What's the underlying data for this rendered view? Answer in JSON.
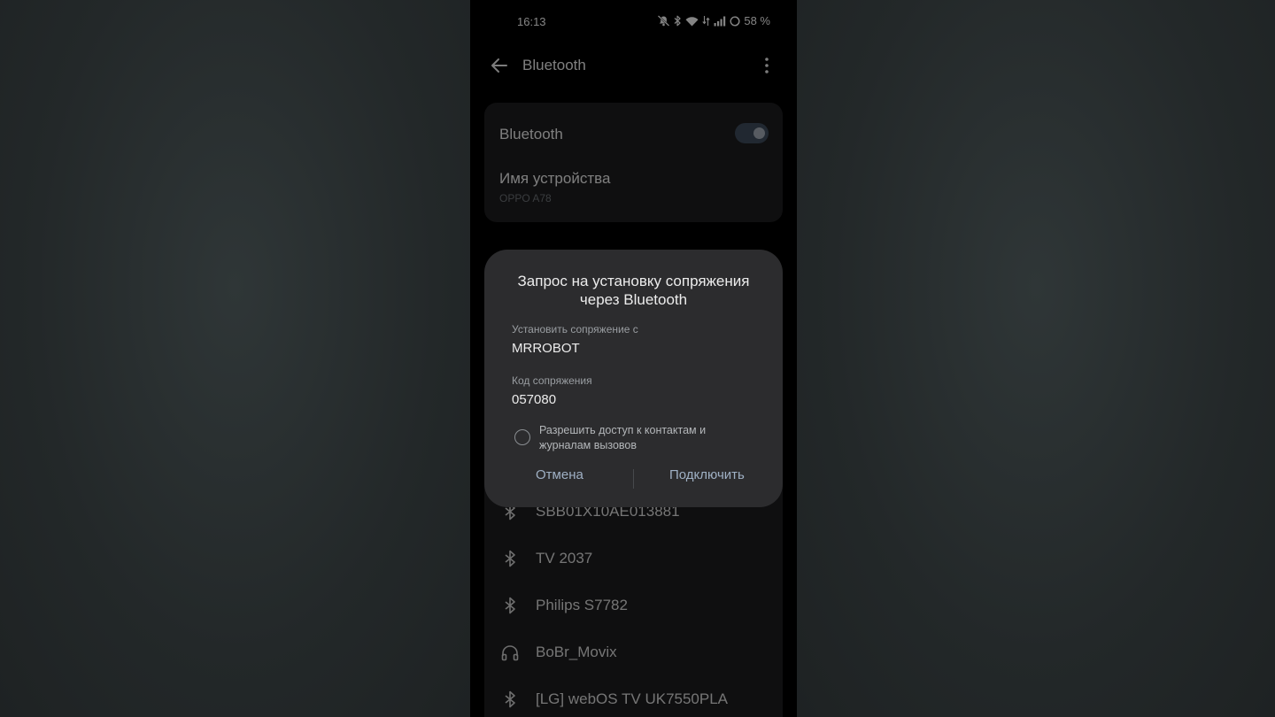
{
  "status_bar": {
    "time": "16:13",
    "battery": "58 %",
    "icons": [
      "mute-vibrate-icon",
      "bluetooth-icon",
      "wifi-icon",
      "data-icon",
      "signal-icon",
      "battery-icon"
    ]
  },
  "app_bar": {
    "title": "Bluetooth",
    "back_icon": "arrow-left-icon",
    "more_icon": "more-vertical-icon"
  },
  "settings": {
    "bluetooth_label": "Bluetooth",
    "bluetooth_enabled": true,
    "device_name_label": "Имя устройства",
    "device_name_value": "OPPO A78"
  },
  "devices": [
    {
      "name": "SBB01X10AE013881",
      "icon": "bluetooth-icon"
    },
    {
      "name": "TV 2037",
      "icon": "bluetooth-icon"
    },
    {
      "name": "Philips S7782",
      "icon": "bluetooth-icon"
    },
    {
      "name": "BoBr_Movix",
      "icon": "headphones-icon"
    },
    {
      "name": "[LG] webOS TV UK7550PLA",
      "icon": "bluetooth-icon"
    }
  ],
  "dialog": {
    "title": "Запрос на установку сопряжения через Bluetooth",
    "pair_with_label": "Установить сопряжение с",
    "pair_with_value": "MRROBOT",
    "code_label": "Код сопряжения",
    "code_value": "057080",
    "allow_access_text": "Разрешить доступ к контактам и журналам вызовов",
    "allow_access_checked": false,
    "cancel_label": "Отмена",
    "connect_label": "Подключить"
  },
  "colors": {
    "background": "#252a2b",
    "phone": "#000000",
    "card": "#1c1c1e",
    "dialog": "#2c2c2e",
    "accent": "#9fb0c4"
  }
}
